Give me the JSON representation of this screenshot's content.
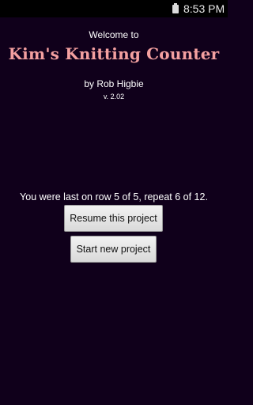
{
  "status_bar": {
    "time": "8:53 PM",
    "battery_icon": "battery-icon"
  },
  "header": {
    "welcome": "Welcome to",
    "app_title": "Kim's Knitting Counter",
    "author": "by Rob Higbie",
    "version": "v. 2.02"
  },
  "main": {
    "last_row_text": "You were last on row 5 of 5, repeat 6 of 12.",
    "resume_label": "Resume this project",
    "new_label": "Start new project"
  },
  "colors": {
    "background": "#10001b",
    "title_accent": "#f4a0a0"
  }
}
